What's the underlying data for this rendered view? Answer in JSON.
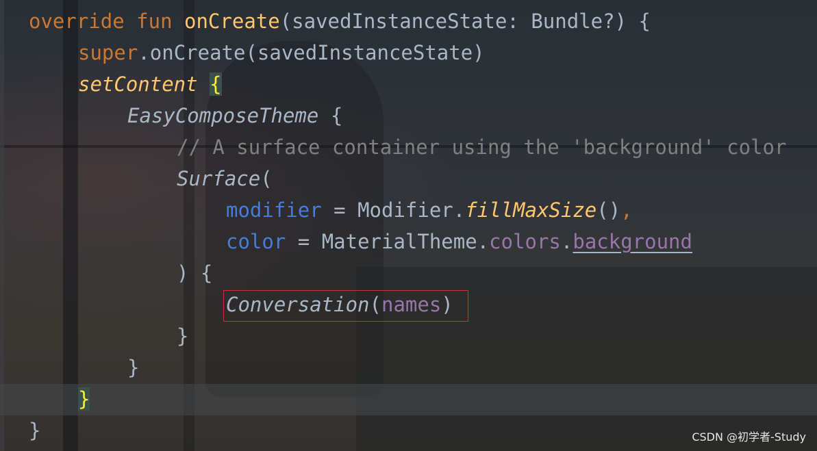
{
  "code_lines": [
    {
      "indent": 0,
      "parts": [
        "override",
        " ",
        "fun",
        " ",
        "onCreate",
        "(savedInstanceState: Bundle?) {"
      ]
    },
    {
      "indent": 1,
      "parts": [
        "super",
        ".onCreate(savedInstanceState)"
      ]
    },
    {
      "indent": 1,
      "parts": [
        "setContent",
        " ",
        "{"
      ]
    },
    {
      "indent": 2,
      "parts": [
        "EasyComposeTheme",
        " {"
      ]
    },
    {
      "indent": 3,
      "parts": [
        "// A surface container using the 'background' color"
      ]
    },
    {
      "indent": 3,
      "parts": [
        "Surface",
        "("
      ]
    },
    {
      "indent": 4,
      "parts": [
        "modifier",
        " = Modifier.",
        "fillMaxSize",
        "()",
        ","
      ]
    },
    {
      "indent": 4,
      "parts": [
        "color",
        " = MaterialTheme.",
        "colors",
        ".",
        "background"
      ]
    },
    {
      "indent": 3,
      "parts": [
        ") {"
      ]
    },
    {
      "indent": 4,
      "parts": [
        "Conversation",
        "(",
        "names",
        ")"
      ]
    },
    {
      "indent": 3,
      "parts": [
        "}"
      ]
    },
    {
      "indent": 2,
      "parts": [
        "}"
      ]
    },
    {
      "indent": 1,
      "parts": [
        "}"
      ]
    },
    {
      "indent": 0,
      "parts": [
        "}"
      ]
    }
  ],
  "watermark": "CSDN @初学者-Study",
  "colors": {
    "keyword": "#cc7832",
    "function_decl": "#ffc66d",
    "comment": "#808080",
    "named_param": "#467cda",
    "property": "#9876aa",
    "default_text": "#a9b7c6",
    "highlight_box": "#d0312d"
  }
}
